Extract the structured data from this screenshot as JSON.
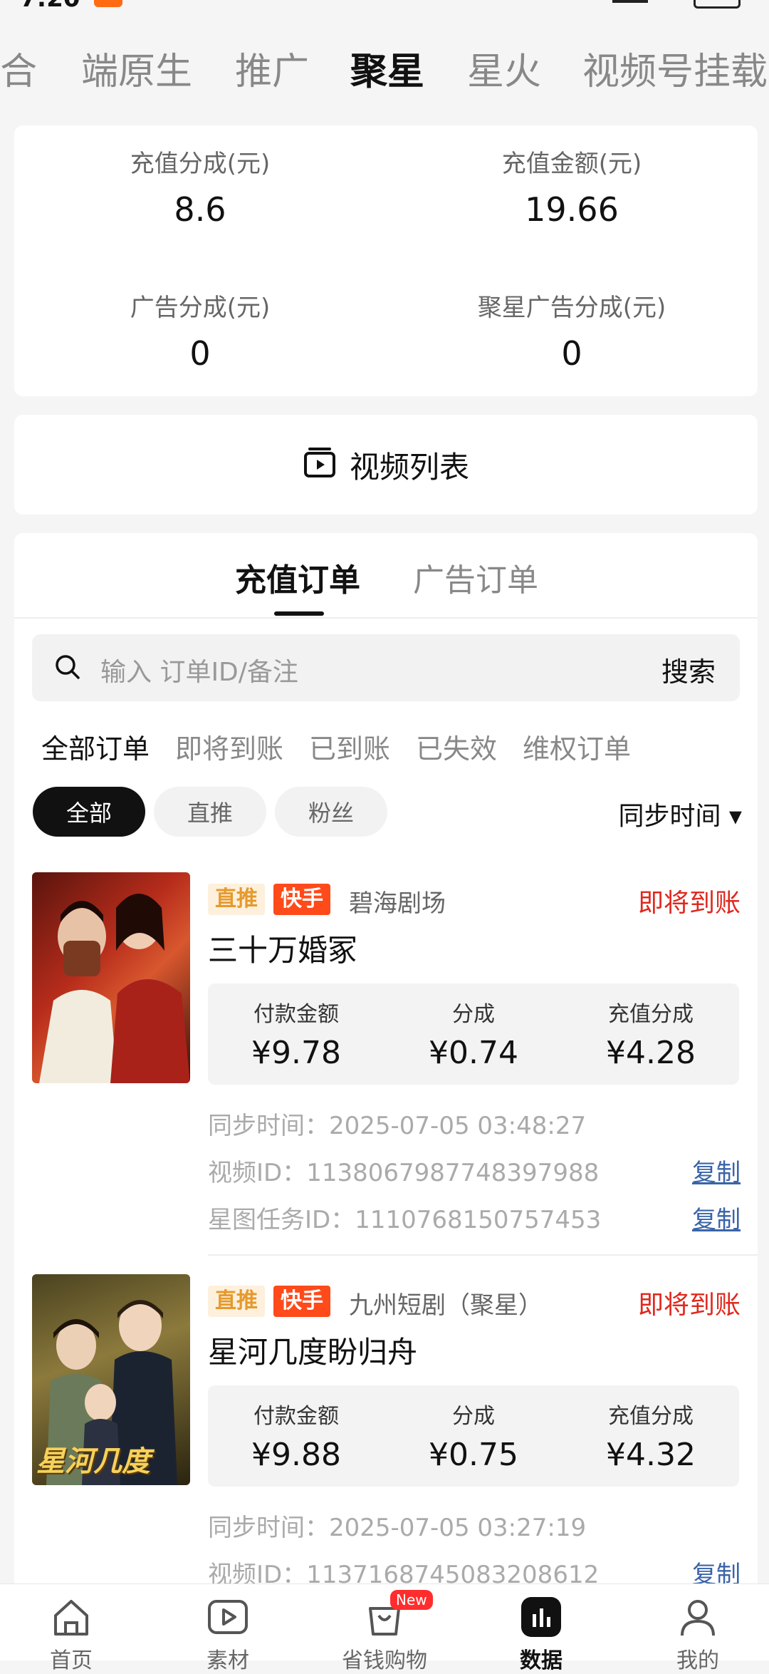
{
  "status": {
    "time": "7:20"
  },
  "topnav": {
    "tabs": [
      "合",
      "端原生",
      "推广",
      "聚星",
      "星火",
      "视频号挂载"
    ],
    "active": "聚星"
  },
  "stats": [
    {
      "label": "充值分成(元)",
      "value": "8.6"
    },
    {
      "label": "充值金额(元)",
      "value": "19.66"
    },
    {
      "label": "广告分成(元)",
      "value": "0"
    },
    {
      "label": "聚星广告分成(元)",
      "value": "0"
    }
  ],
  "video_list": {
    "label": "视频列表"
  },
  "order_tabs": {
    "recharge": "充值订单",
    "ad": "广告订单"
  },
  "search": {
    "placeholder": "输入 订单ID/备注",
    "button": "搜索"
  },
  "filters": [
    "全部订单",
    "即将到账",
    "已到账",
    "已失效",
    "维权订单"
  ],
  "chips": [
    "全部",
    "直推",
    "粉丝"
  ],
  "sync_sort": "同步时间 ▾",
  "orders": [
    {
      "tag_direct": "直推",
      "tag_platform": "快手",
      "theater": "碧海剧场",
      "status": "即将到账",
      "title": "三十万婚冢",
      "amounts": [
        {
          "label": "付款金额",
          "value": "¥9.78"
        },
        {
          "label": "分成",
          "value": "¥0.74"
        },
        {
          "label": "充值分成",
          "value": "¥4.28"
        }
      ],
      "sync_time": "同步时间：2025-07-05 03:48:27",
      "video_id": "视频ID：1138067987748397988",
      "task_id": "星图任务ID：1110768150757453",
      "copy": "复制",
      "poster_colors": [
        "#6b1a12",
        "#c7341f",
        "#2a0d08"
      ]
    },
    {
      "tag_direct": "直推",
      "tag_platform": "快手",
      "theater": "九州短剧（聚星）",
      "status": "即将到账",
      "title": "星河几度盼归舟",
      "amounts": [
        {
          "label": "付款金额",
          "value": "¥9.88"
        },
        {
          "label": "分成",
          "value": "¥0.75"
        },
        {
          "label": "充值分成",
          "value": "¥4.32"
        }
      ],
      "sync_time": "同步时间：2025-07-05 03:27:19",
      "video_id": "视频ID：1137168745083208612",
      "copy": "复制",
      "poster_text": "星河几度",
      "poster_colors": [
        "#3d3a1c",
        "#8a7a3a",
        "#1d1a0c"
      ]
    }
  ],
  "bottomnav": [
    {
      "label": "首页",
      "icon": "home-icon"
    },
    {
      "label": "素材",
      "icon": "play-icon"
    },
    {
      "label": "省钱购物",
      "icon": "shopping-bag-icon",
      "badge": "New"
    },
    {
      "label": "数据",
      "icon": "data-chart-icon",
      "active": true
    },
    {
      "label": "我的",
      "icon": "profile-icon"
    }
  ]
}
